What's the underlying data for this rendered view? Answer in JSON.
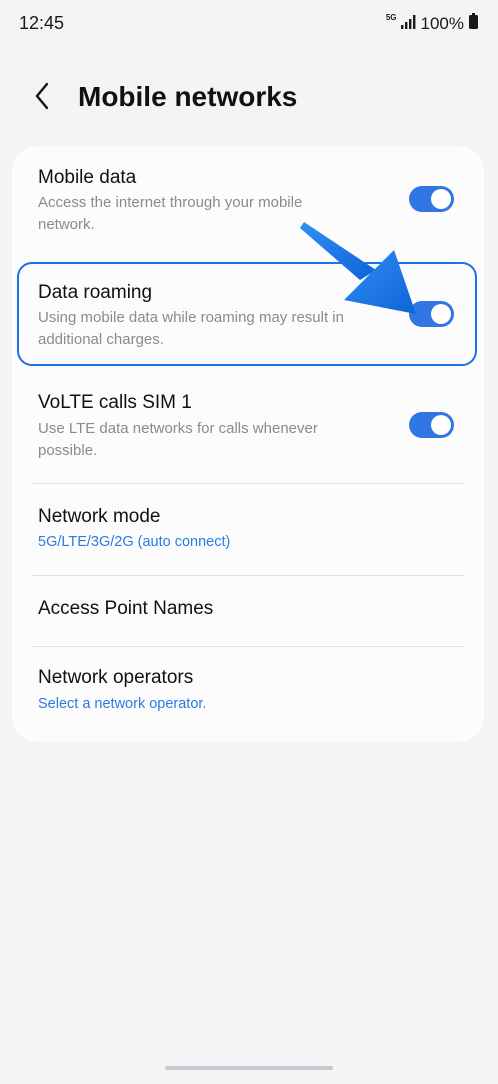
{
  "status_bar": {
    "time": "12:45",
    "network": "5G",
    "battery": "100%",
    "icons": [
      "signal-icon",
      "battery-icon"
    ]
  },
  "header": {
    "back_icon": "chevron-left-icon",
    "title": "Mobile networks"
  },
  "settings": {
    "mobile_data": {
      "title": "Mobile data",
      "description": "Access the internet through your mobile network.",
      "enabled": true
    },
    "data_roaming": {
      "title": "Data roaming",
      "description": "Using mobile data while roaming may result in additional charges.",
      "enabled": true,
      "highlighted": true
    },
    "volte": {
      "title": "VoLTE calls SIM 1",
      "description": "Use LTE data networks for calls whenever possible.",
      "enabled": true
    },
    "network_mode": {
      "title": "Network mode",
      "value": "5G/LTE/3G/2G (auto connect)"
    },
    "apn": {
      "title": "Access Point Names"
    },
    "network_operators": {
      "title": "Network operators",
      "value": "Select a network operator."
    }
  },
  "colors": {
    "accent": "#3275e4",
    "link": "#2d7ae0",
    "highlight": "#1f6fe5",
    "background": "#f4f4f7",
    "card": "#fcfcfd"
  }
}
